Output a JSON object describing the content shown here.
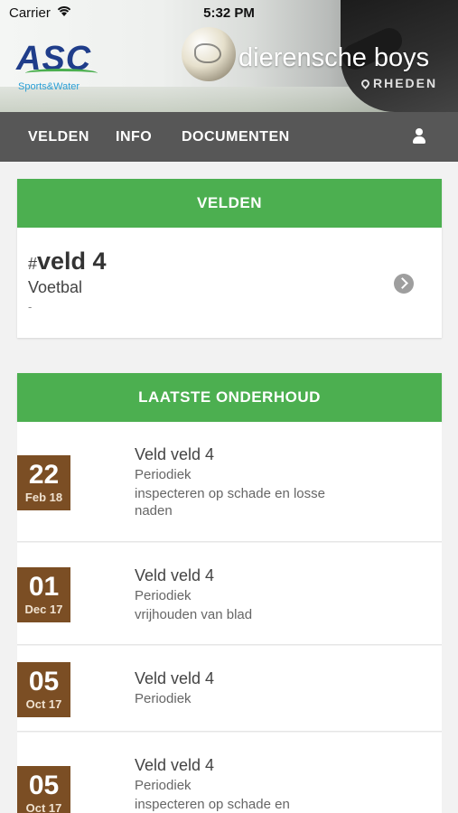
{
  "status_bar": {
    "carrier": "Carrier",
    "time": "5:32 PM"
  },
  "header": {
    "logo_letters": "ASC",
    "logo_subtitle": "Sports&Water",
    "club_name": "dierensche boys",
    "club_location": "RHEDEN"
  },
  "nav": {
    "items": [
      "VELDEN",
      "INFO",
      "DOCUMENTEN"
    ]
  },
  "velden": {
    "header": "VELDEN",
    "veld": {
      "hash": "#",
      "name": "veld 4",
      "sport": "Voetbal",
      "extra": "-"
    }
  },
  "onderhoud": {
    "header": "LAATSTE ONDERHOUD",
    "items": [
      {
        "day": "22",
        "month": "Feb 18",
        "title": "Veld veld 4",
        "type": "Periodiek",
        "desc": "inspecteren op schade en losse naden"
      },
      {
        "day": "01",
        "month": "Dec 17",
        "title": "Veld veld 4",
        "type": "Periodiek",
        "desc": "vrijhouden van blad"
      },
      {
        "day": "05",
        "month": "Oct 17",
        "title": "Veld veld 4",
        "type": "Periodiek",
        "desc": ""
      },
      {
        "day": "05",
        "month": "Oct 17",
        "title": "Veld veld 4",
        "type": "Periodiek",
        "desc": "inspecteren op schade en"
      }
    ]
  },
  "colors": {
    "accent_green": "#4caf50",
    "navbar": "#575757",
    "date_badge": "#7b4e24"
  },
  "icons": [
    "wifi-icon",
    "location-pin-icon",
    "user-icon",
    "chevron-right-circle-icon"
  ]
}
